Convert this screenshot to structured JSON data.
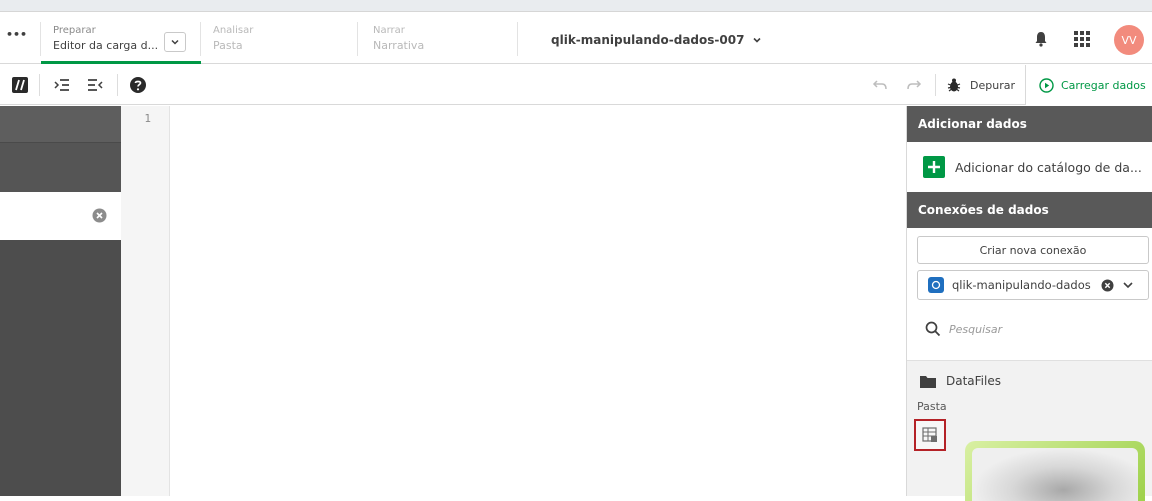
{
  "nav": {
    "menu_glyph": "•••",
    "steps": [
      {
        "label": "Preparar",
        "value": "Editor da carga d..."
      },
      {
        "label": "Analisar",
        "value": "Pasta"
      },
      {
        "label": "Narrar",
        "value": "Narrativa"
      }
    ],
    "app_title": "qlik-manipulando-dados-007",
    "avatar_initials": "VV"
  },
  "toolbar": {
    "debug_label": "Depurar",
    "load_label": "Carregar dados"
  },
  "editor": {
    "line_numbers": [
      "1"
    ]
  },
  "right_panel": {
    "add_data_header": "Adicionar dados",
    "add_from_catalog": "Adicionar do catálogo de da...",
    "connections_header": "Conexões de dados",
    "create_connection": "Criar nova conexão",
    "selected_space": "qlik-manipulando-dados",
    "search_placeholder": "Pesquisar",
    "folder_name": "DataFiles",
    "folder_type": "Pasta"
  },
  "colors": {
    "accent_green": "#009845",
    "avatar_bg": "#f28b7d",
    "header_gray": "#595959",
    "panel_dark": "#4d4d4d",
    "selected_red_border": "#b42227"
  }
}
